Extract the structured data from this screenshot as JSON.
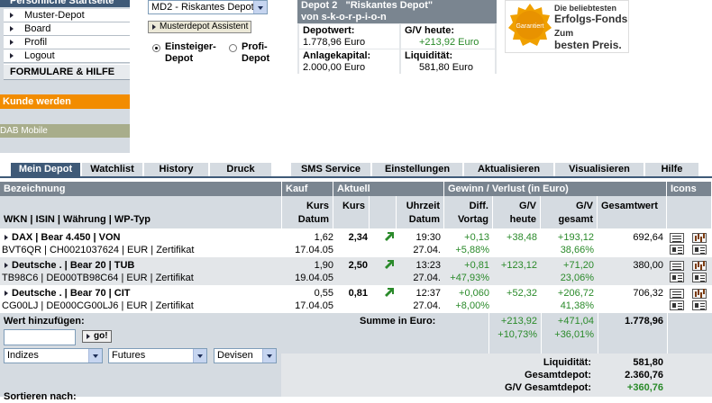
{
  "nav": {
    "header": "Persönliche Startseite",
    "items": [
      "Muster-Depot",
      "Board",
      "Profil",
      "Logout"
    ],
    "formulare": "FORMULARE & HILFE",
    "kunde": "Kunde werden",
    "mobile": "DAB Mobile"
  },
  "controls": {
    "depot_select": "MD2 - Riskantes Depot",
    "assistant_button": "Musterdepot Assistent",
    "radio_einsteiger": "Einsteiger-\nDepot",
    "radio_profi": "Profi-\nDepot",
    "selected_mode": "einsteiger"
  },
  "depot": {
    "title": "Depot 2   \"Riskantes Depot\"",
    "owner": "von s-k-o-r-p-i-o-n",
    "depotwert_label": "Depotwert:",
    "depotwert": "1.778,96 Euro",
    "gv_heute_label": "G/V heute:",
    "gv_heute": "+213,92 Euro",
    "anlagekapital_label": "Anlagekapital:",
    "anlagekapital": "2.000,00 Euro",
    "liquiditaet_label": "Liquidität:",
    "liquiditaet": "581,80 Euro"
  },
  "ad": {
    "badge": "Garantiert",
    "line1": "Die beliebtesten",
    "line2": "Erfolgs-Fonds.",
    "line3": "Zum",
    "line4": "besten Preis."
  },
  "tabs": [
    "Mein Depot",
    "Watchlist",
    "History",
    "Druck",
    "SMS Service",
    "Einstellungen",
    "Aktualisieren",
    "Visualisieren",
    "Hilfe"
  ],
  "table": {
    "h_bezeichnung": "Bezeichnung",
    "h_kauf": "Kauf",
    "h_aktuell": "Aktuell",
    "h_gv": "Gewinn / Verlust  (in Euro)",
    "h_icons": "Icons",
    "s_wkn": "WKN | ISIN | Währung | WP-Typ",
    "s_kurs": "Kurs",
    "s_datum": "Datum",
    "s_kurs2": "Kurs",
    "s_uhrzeit": "Uhrzeit",
    "s_datum2": "Datum",
    "s_diff": "Diff.",
    "s_vortag": "Vortag",
    "s_gv1": "G/V",
    "s_heute": "heute",
    "s_gv2": "G/V",
    "s_gesamt": "gesamt",
    "s_gesamtwert": "Gesamtwert",
    "rows": [
      {
        "name": "DAX | Bear 4.450 | VON",
        "sub": "BVT6QR | CH0021037624 | EUR | Zertifikat",
        "kauf_kurs": "1,62",
        "kauf_datum": "17.04.05",
        "kurs": "2,34",
        "zeit": "19:30",
        "datum": "27.04.",
        "diff": "+0,13",
        "diff_pct": "+5,88%",
        "gv_heute": "+38,48",
        "gv_gesamt": "+193,12",
        "gv_pct": "38,66%",
        "wert": "692,64"
      },
      {
        "name": "Deutsche . | Bear 20 | TUB",
        "sub": "TB98C6 | DE000TB98C64 | EUR | Zertifikat",
        "kauf_kurs": "1,90",
        "kauf_datum": "19.04.05",
        "kurs": "2,50",
        "zeit": "13:23",
        "datum": "27.04.",
        "diff": "+0,81",
        "diff_pct": "+47,93%",
        "gv_heute": "+123,12",
        "gv_gesamt": "+71,20",
        "gv_pct": "23,06%",
        "wert": "380,00"
      },
      {
        "name": "Deutsche . | Bear 70 | CIT",
        "sub": "CG00LJ | DE000CG00LJ6 | EUR | Zertifikat",
        "kauf_kurs": "0,55",
        "kauf_datum": "17.04.05",
        "kurs": "0,81",
        "zeit": "12:37",
        "datum": "27.04.",
        "diff": "+0,060",
        "diff_pct": "+8,00%",
        "gv_heute": "+52,32",
        "gv_gesamt": "+206,72",
        "gv_pct": "41,38%",
        "wert": "706,32"
      }
    ]
  },
  "bottom": {
    "wert_label": "Wert hinzufügen:",
    "go": "go!",
    "select1": "Indizes",
    "select2": "Futures",
    "select3": "Devisen",
    "sortieren": "Sortieren nach:",
    "summe_label": "Summe in Euro:",
    "sum_heute": "+213,92",
    "sum_heute_pct": "+10,73%",
    "sum_gesamt": "+471,04",
    "sum_gesamt_pct": "+36,01%",
    "sum_wert": "1.778,96",
    "liq_label": "Liquidität:",
    "liq": "581,80",
    "gesamtdepot_label": "Gesamtdepot:",
    "gesamtdepot": "2.360,76",
    "gv_gesamtdepot_label": "G/V Gesamtdepot:",
    "gv_gesamtdepot": "+360,76"
  },
  "colors": {
    "nav_dark": "#3f5a78",
    "orange": "#f28c00",
    "green": "#2a8a2a",
    "header_grey": "#7a8590"
  }
}
